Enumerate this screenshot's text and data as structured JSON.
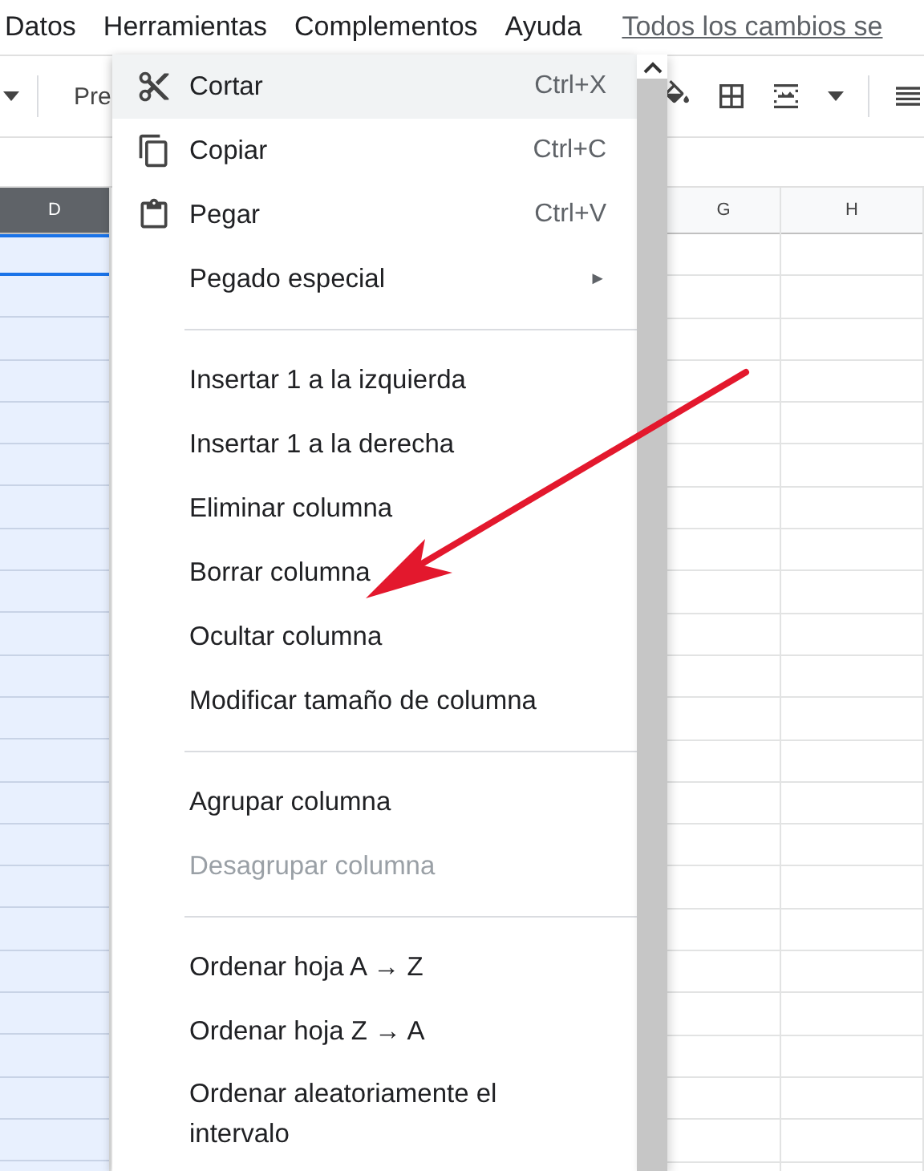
{
  "menu_bar": [
    {
      "label": "Datos"
    },
    {
      "label": "Herramientas"
    },
    {
      "label": "Complementos"
    },
    {
      "label": "Ayuda"
    }
  ],
  "save_status": "Todos los cambios se",
  "toolbar": {
    "font_field": "Pre"
  },
  "columns": [
    {
      "label": "D",
      "selected": true
    },
    {
      "label": "G",
      "selected": false
    },
    {
      "label": "H",
      "selected": false
    }
  ],
  "context_menu": {
    "sections": [
      {
        "items": [
          {
            "label": "Cortar",
            "shortcut": "Ctrl+X",
            "selected": true,
            "disabled": false
          },
          {
            "label": "Copiar",
            "shortcut": "Ctrl+C",
            "selected": false,
            "disabled": false
          },
          {
            "label": "Pegar",
            "shortcut": "Ctrl+V",
            "selected": false,
            "disabled": false
          },
          {
            "label": "Pegado especial",
            "arrow": "►",
            "selected": false,
            "disabled": false
          }
        ]
      },
      {
        "items": [
          {
            "label": "Insertar 1 a la izquierda",
            "selected": false,
            "disabled": false
          },
          {
            "label": "Insertar 1 a la derecha",
            "selected": false,
            "disabled": false
          },
          {
            "label": "Eliminar columna",
            "selected": false,
            "disabled": false
          },
          {
            "label": "Borrar columna",
            "selected": false,
            "disabled": false
          },
          {
            "label": "Ocultar columna",
            "selected": false,
            "disabled": false
          },
          {
            "label": "Modificar tamaño de columna",
            "selected": false,
            "disabled": false
          }
        ]
      },
      {
        "items": [
          {
            "label": "Agrupar columna",
            "selected": false,
            "disabled": false
          },
          {
            "label": "Desagrupar columna",
            "selected": false,
            "disabled": true
          }
        ]
      },
      {
        "items": [
          {
            "label": "Ordenar hoja A → Z",
            "selected": false,
            "disabled": false
          },
          {
            "label": "Ordenar hoja Z → A",
            "selected": false,
            "disabled": false
          },
          {
            "label": "Ordenar aleatoriamente el intervalo",
            "selected": false,
            "disabled": false
          }
        ]
      }
    ]
  }
}
